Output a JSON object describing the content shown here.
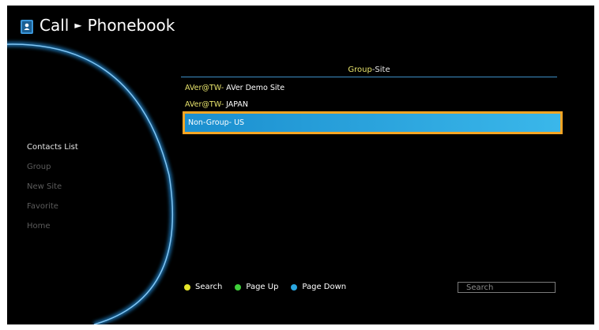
{
  "header": {
    "app": "Call",
    "separator": "►",
    "title": "Phonebook"
  },
  "sidebar": {
    "items": [
      {
        "label": "Contacts List"
      },
      {
        "label": "Group"
      },
      {
        "label": "New Site"
      },
      {
        "label": "Favorite"
      },
      {
        "label": "Home"
      }
    ]
  },
  "list": {
    "header_group": "Group",
    "header_site": "-Site",
    "rows": [
      {
        "group": "AVer@TW-",
        "site": " AVer Demo Site"
      },
      {
        "group": "AVer@TW-",
        "site": " JAPAN"
      },
      {
        "group": "Non-Group-",
        "site": " US"
      }
    ]
  },
  "footer": {
    "search_label": "Search",
    "page_up_label": "Page Up",
    "page_down_label": "Page Down",
    "search_placeholder": "Search"
  },
  "colors": {
    "background": "#000000",
    "accent_yellow": "#e7e36c",
    "selection_fill": "#2aa6e0",
    "selection_border": "#f5a524",
    "key_yellow": "#e5e52a",
    "key_green": "#3fcf3a",
    "key_blue": "#2aa6e0"
  },
  "icons": {
    "header": "phonebook-icon"
  }
}
